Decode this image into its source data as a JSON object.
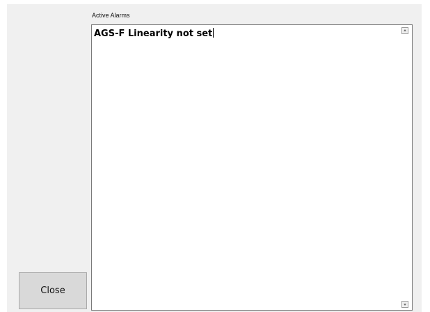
{
  "alarms": {
    "label": "Active Alarms",
    "text": "AGS-F Linearity not set"
  },
  "buttons": {
    "close_label": "Close"
  },
  "icons": {
    "scroll_up": "scroll-up-arrow-icon",
    "scroll_down": "scroll-down-arrow-icon"
  }
}
